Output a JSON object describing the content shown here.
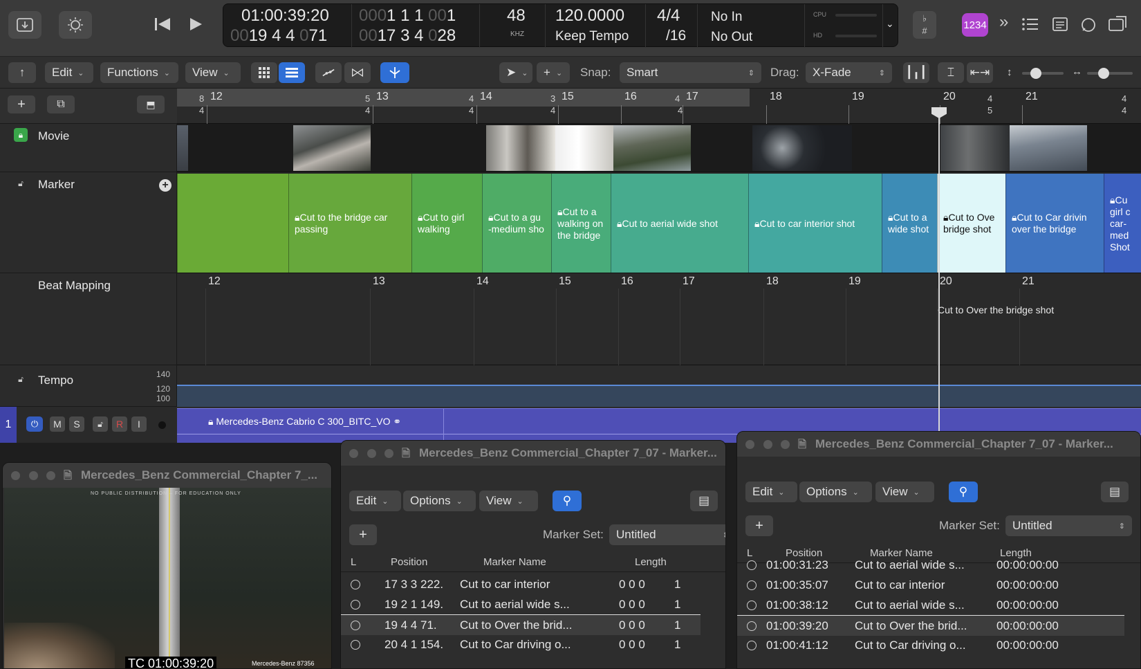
{
  "control_bar": {
    "lcd": {
      "timecode": "01:00:39:20",
      "bars_beats_dim": "00",
      "bars_beats": "19 4 4",
      "bars_beats_tick_dim": "0",
      "bars_beats_tick": "71",
      "left_top_dim": "000",
      "left_top": "1  1  1",
      "left_top_tick_dim": "00",
      "left_top_tick": "1",
      "left_bottom_dim": "00",
      "left_bottom": "17  3  4",
      "left_bottom_tick_dim": "0",
      "left_bottom_tick": "28",
      "sample_rate": "48",
      "sample_rate_unit": "KHZ",
      "tempo": "120.0000",
      "tempo_mode": "Keep Tempo",
      "signature": "4/4",
      "division": "/16",
      "in_label": "No In",
      "out_label": "No Out",
      "cpu_label": "CPU",
      "hd_label": "HD"
    },
    "key_label": "♭\n#",
    "count_in": "1234"
  },
  "toolbar": {
    "edit": "Edit",
    "functions": "Functions",
    "view": "View",
    "snap_label": "Snap:",
    "snap_value": "Smart",
    "drag_label": "Drag:",
    "drag_value": "X-Fade"
  },
  "tracks": {
    "movie": "Movie",
    "marker": "Marker",
    "beat_mapping": "Beat Mapping",
    "tempo": "Tempo",
    "tempo_scale": [
      "140",
      "120",
      "100"
    ],
    "audio_track_number": "1",
    "audio_buttons": [
      "M",
      "S",
      "R",
      "I"
    ],
    "audio_region_name": "Mercedes-Benz Cabrio C 300_BITC_VO"
  },
  "ruler": {
    "bars": [
      "12",
      "13",
      "14",
      "15",
      "16",
      "17",
      "18",
      "19",
      "20",
      "21"
    ],
    "sigs": [
      "8",
      "4",
      "5",
      "4",
      "4",
      "4",
      "3",
      "4",
      "4",
      "4",
      "4",
      "5",
      "4",
      "4",
      "4"
    ]
  },
  "markers": [
    {
      "label": "",
      "color": "#6aaa36"
    },
    {
      "label": "Cut to the bridge car passing",
      "color": "#67a83c"
    },
    {
      "label": "Cut to girl walking",
      "color": "#55aa4a"
    },
    {
      "label": "Cut to a gu -medium sho",
      "color": "#4fac66"
    },
    {
      "label": "Cut to a walking on the bridge",
      "color": "#49ac7a"
    },
    {
      "label": "Cut to aerial wide shot",
      "color": "#47ab8e"
    },
    {
      "label": "Cut to car interior shot",
      "color": "#44a8a0"
    },
    {
      "label": "Cut to a wide shot",
      "color": "#3d8cb6"
    },
    {
      "label": "Cut to Ove bridge shot",
      "color": "#dff7f9"
    },
    {
      "label": "Cut to Car drivin over the bridge",
      "color": "#3f74c0"
    },
    {
      "label": "Cu girl c car- med Shot",
      "color": "#3c5fbf"
    }
  ],
  "beat_lane": {
    "bars": [
      "12",
      "13",
      "14",
      "15",
      "16",
      "17",
      "18",
      "19",
      "20",
      "21"
    ],
    "current_marker": "Cut to Over the bridge shot"
  },
  "movie_window": {
    "title": "Mercedes_Benz Commercial_Chapter 7_...",
    "overlay_top": "NO PUBLIC DISTRIBUTION – FOR EDUCATION ONLY",
    "timecode": "TC 01:00:39:20",
    "watermark": "Mercedes-Benz 87356"
  },
  "marker_list_1": {
    "title": "Mercedes_Benz Commercial_Chapter 7_07 - Marker...",
    "edit": "Edit",
    "options": "Options",
    "view": "View",
    "marker_set_label": "Marker Set:",
    "marker_set_value": "Untitled",
    "columns": [
      "L",
      "Position",
      "Marker Name",
      "Length"
    ],
    "rows": [
      {
        "position": "17  3  3  222.",
        "name": "Cut to car interior",
        "length": "0  0  0",
        "len_tick": "1"
      },
      {
        "position": "19  2  1  149.",
        "name": "Cut to aerial wide s...",
        "length": "0  0  0",
        "len_tick": "1"
      },
      {
        "position": "19  4  4    71.",
        "name": "Cut to Over the brid...",
        "length": "0  0  0",
        "len_tick": "1"
      },
      {
        "position": "20  4  1  154.",
        "name": "Cut to Car driving o...",
        "length": "0  0  0",
        "len_tick": "1"
      }
    ],
    "selected_row": 2
  },
  "marker_list_2": {
    "title": "Mercedes_Benz Commercial_Chapter 7_07 - Marker...",
    "edit": "Edit",
    "options": "Options",
    "view": "View",
    "marker_set_label": "Marker Set:",
    "marker_set_value": "Untitled",
    "columns": [
      "L",
      "Position",
      "Marker Name",
      "Length"
    ],
    "rows": [
      {
        "position": "01:00:31:23",
        "name": "Cut to aerial wide s...",
        "length": "00:00:00:00"
      },
      {
        "position": "01:00:35:07",
        "name": "Cut to car interior",
        "length": "00:00:00:00"
      },
      {
        "position": "01:00:38:12",
        "name": "Cut to aerial wide s...",
        "length": "00:00:00:00"
      },
      {
        "position": "01:00:39:20",
        "name": "Cut to Over the brid...",
        "length": "00:00:00:00"
      },
      {
        "position": "01:00:41:12",
        "name": "Cut to Car driving o...",
        "length": "00:00:00:00"
      }
    ],
    "selected_row": 3
  }
}
